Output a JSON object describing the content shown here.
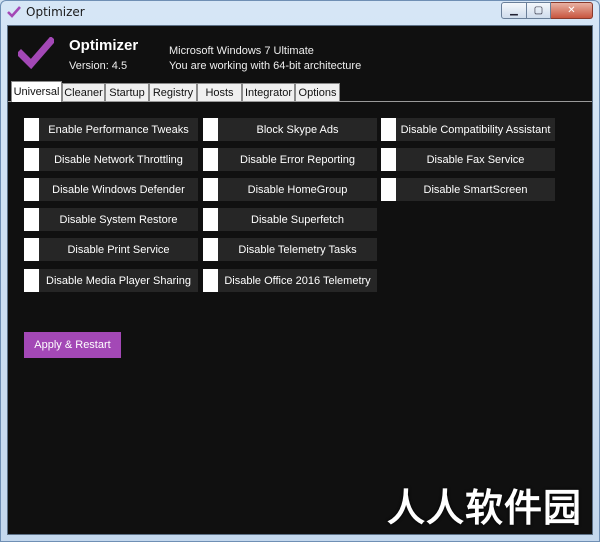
{
  "window": {
    "title": "Optimizer"
  },
  "header": {
    "app_name": "Optimizer",
    "version": "Version: 4.5",
    "os": "Microsoft Windows 7 Ultimate",
    "arch": "You are working with 64-bit architecture"
  },
  "tabs": [
    {
      "label": "Universal",
      "active": true
    },
    {
      "label": "Cleaner"
    },
    {
      "label": "Startup"
    },
    {
      "label": "Registry"
    },
    {
      "label": "Hosts"
    },
    {
      "label": "Integrator"
    },
    {
      "label": "Options"
    }
  ],
  "tweaks": {
    "col1": [
      "Enable Performance Tweaks",
      "Disable Network Throttling",
      "Disable Windows Defender",
      "Disable System Restore",
      "Disable Print Service",
      "Disable Media Player Sharing"
    ],
    "col2": [
      "Block Skype Ads",
      "Disable Error Reporting",
      "Disable HomeGroup",
      "Disable Superfetch",
      "Disable Telemetry Tasks",
      "Disable Office 2016 Telemetry"
    ],
    "col3": [
      "Disable Compatibility Assistant",
      "Disable Fax Service",
      "Disable SmartScreen"
    ]
  },
  "apply_label": "Apply & Restart",
  "watermark": "人人软件园",
  "colors": {
    "accent": "#a348b6",
    "background": "#101010",
    "tweak_bg": "#262626"
  }
}
